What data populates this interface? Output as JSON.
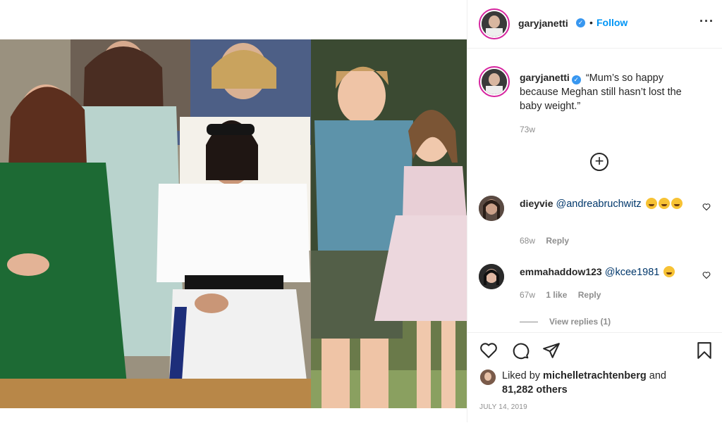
{
  "header": {
    "username": "garyjanetti",
    "separator": "•",
    "follow_label": "Follow",
    "more_icon": "more-horizontal-icon"
  },
  "caption": {
    "username": "garyjanetti",
    "text": "“Mum’s so happy because Meghan still hasn’t lost the baby weight.”",
    "time": "73w"
  },
  "comments": [
    {
      "username": "dieyvie",
      "mention": "@andreabruchwitz",
      "emoji_count": 3,
      "time": "68w",
      "reply_label": "Reply"
    },
    {
      "username": "emmahaddow123",
      "mention": "@kcee1981",
      "emoji_count": 1,
      "time": "67w",
      "likes": "1 like",
      "reply_label": "Reply",
      "view_replies": "View replies (1)"
    }
  ],
  "footer": {
    "liked_by_prefix": "Liked by",
    "liked_by_user": "michelletrachtenberg",
    "liked_by_and": "and",
    "liked_by_others": "81,282 others",
    "date": "JULY 14, 2019"
  },
  "colors": {
    "accent": "#0095f6",
    "verified": "#3897f0",
    "muted": "#8e8e8e",
    "text": "#262626"
  }
}
